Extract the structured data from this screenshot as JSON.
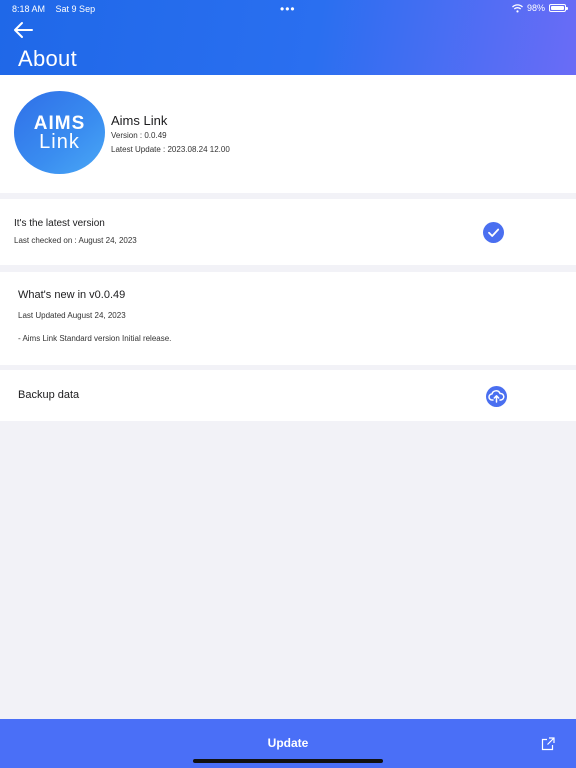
{
  "status_bar": {
    "time": "8:18 AM",
    "date": "Sat 9 Sep",
    "battery": "98%",
    "battery_level": 0.98
  },
  "header": {
    "title": "About",
    "back_icon": "arrow-left-icon"
  },
  "app": {
    "logo_top": "AIMS",
    "logo_bottom": "Link",
    "name": "Aims Link",
    "version": "Version : 0.0.49",
    "latest_update": "Latest Update : 2023.08.24 12.00"
  },
  "latest": {
    "title": "It's the latest version",
    "last_checked": "Last checked on : August 24, 2023",
    "icon": "checkmark-circle-icon"
  },
  "whats_new": {
    "title": "What's new in v0.0.49",
    "updated": "Last Updated August 24, 2023",
    "note": "- Aims Link Standard version Initial release."
  },
  "backup": {
    "label": "Backup data",
    "icon": "cloud-upload-icon"
  },
  "footer": {
    "update_label": "Update",
    "external_icon": "external-link-icon"
  },
  "colors": {
    "accent": "#4a6ff7",
    "header_start": "#1f68e8",
    "header_end": "#6a6cf6",
    "background": "#f2f2f7"
  }
}
